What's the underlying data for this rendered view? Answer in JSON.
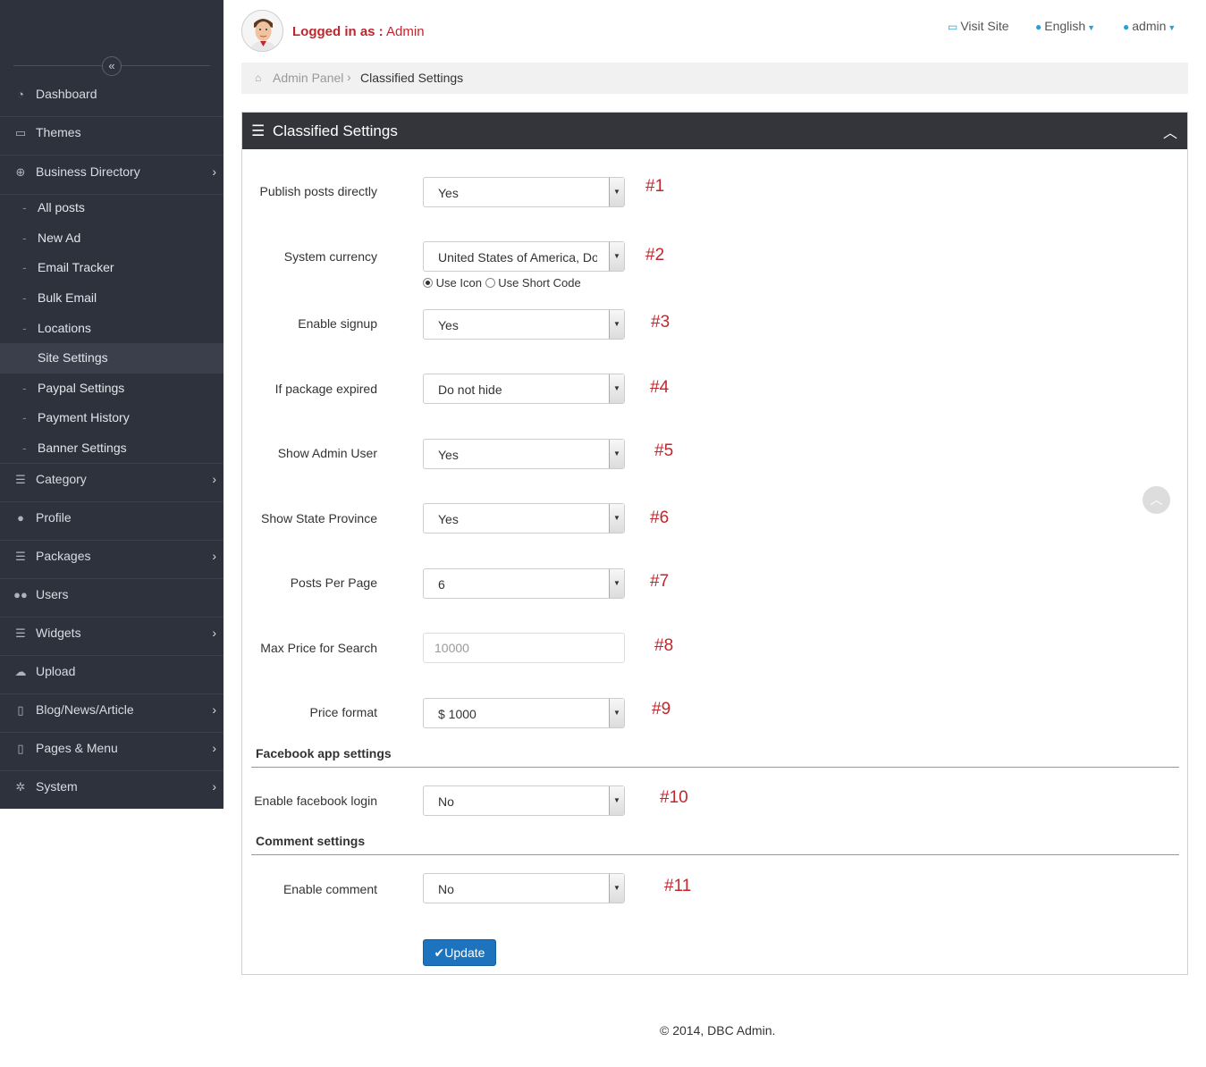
{
  "sidebar": {
    "collapse_icon": "double-chevron-left-icon",
    "items": [
      {
        "label": "Dashboard",
        "icon": "dashboard-icon"
      },
      {
        "label": "Themes",
        "icon": "monitor-icon"
      },
      {
        "label": "Business Directory",
        "icon": "plus-circle-icon"
      },
      {
        "label": "Category",
        "icon": "list-icon"
      },
      {
        "label": "Profile",
        "icon": "user-icon"
      },
      {
        "label": "Packages",
        "icon": "list-icon"
      },
      {
        "label": "Users",
        "icon": "users-icon"
      },
      {
        "label": "Widgets",
        "icon": "list-icon"
      },
      {
        "label": "Upload",
        "icon": "cloud-upload-icon"
      },
      {
        "label": "Blog/News/Article",
        "icon": "file-icon"
      },
      {
        "label": "Pages & Menu",
        "icon": "file-icon"
      },
      {
        "label": "System",
        "icon": "gear-icon"
      }
    ],
    "subitems": [
      "All posts",
      "New Ad",
      "Email Tracker",
      "Bulk Email",
      "Locations",
      "Site Settings",
      "Paypal Settings",
      "Payment History",
      "Banner Settings"
    ],
    "active_subitem": "Site Settings"
  },
  "header": {
    "logged_prefix": "Logged in as :",
    "logged_user": "Admin",
    "visit_site": "Visit Site",
    "language": "English",
    "user_menu": "admin"
  },
  "breadcrumb": {
    "root": "Admin Panel",
    "current": "Classified Settings"
  },
  "panel": {
    "title": "Classified Settings",
    "fields": [
      {
        "label": "Publish posts directly",
        "value": "Yes",
        "note": "#1"
      },
      {
        "label": "System currency",
        "value": "United States of America, Dollars",
        "note": "#2"
      },
      {
        "label": "Enable signup",
        "value": "Yes",
        "note": "#3"
      },
      {
        "label": "If package expired",
        "value": "Do not hide",
        "note": "#4"
      },
      {
        "label": "Show Admin User",
        "value": "Yes",
        "note": "#5"
      },
      {
        "label": "Show State Province",
        "value": "Yes",
        "note": "#6"
      },
      {
        "label": "Posts Per Page",
        "value": "6",
        "note": "#7"
      },
      {
        "label": "Max Price for Search",
        "placeholder": "10000",
        "note": "#8"
      },
      {
        "label": "Price format",
        "value": "$ 1000",
        "note": "#9"
      },
      {
        "label": "Enable facebook login",
        "value": "No",
        "note": "#10"
      },
      {
        "label": "Enable comment",
        "value": "No",
        "note": "#11"
      }
    ],
    "currency_radios": {
      "use_icon": "Use Icon",
      "use_short_code": "Use Short Code",
      "selected": "Use Icon"
    },
    "sections": {
      "facebook": "Facebook app settings",
      "comment": "Comment settings"
    },
    "update_label": "Update"
  },
  "footer": {
    "text": "© 2014, DBC Admin."
  },
  "colors": {
    "sidebar_bg": "#2e323d",
    "accent_red": "#c0272d",
    "link_blue": "#2a9fd6",
    "button_blue": "#1d73be",
    "panel_head": "#33353a"
  }
}
